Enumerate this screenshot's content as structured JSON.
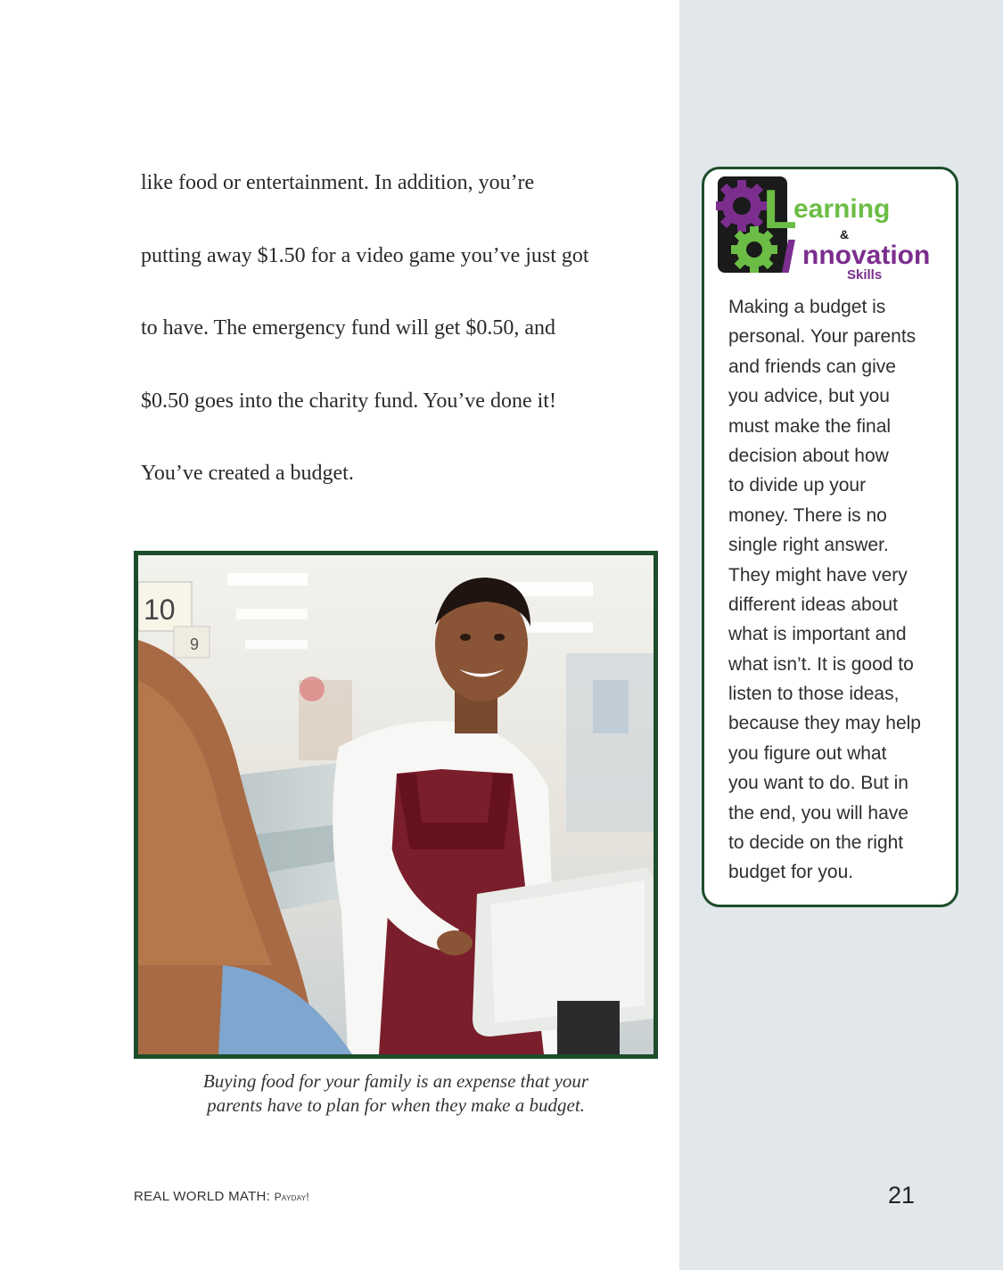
{
  "body": {
    "lines": [
      "like food or entertainment. In addition, you’re",
      "putting away $1.50 for a video game you’ve just got",
      "to have. The emergency fund will get $0.50, and",
      "$0.50 goes into the charity fund. You’ve done it!",
      "You’ve created a budget."
    ]
  },
  "photo": {
    "aisle_sign": "10",
    "aisle_sign_2": "9"
  },
  "caption": {
    "line1": "Buying food for your family is an expense that your",
    "line2": "parents have to plan for when they make a budget."
  },
  "sidebar": {
    "logo": {
      "letter_l": "L",
      "word1": "earning",
      "amp": "&",
      "letter_i": "I",
      "word2": "nnovation",
      "word3": "Skills"
    },
    "lines": [
      "Making a budget is",
      "personal. Your parents",
      "and friends can give",
      "you advice, but you",
      "must make the final",
      "decision about how",
      "to divide up your",
      "money. There is no",
      "single right answer.",
      "They might have very",
      "different ideas about",
      "what is important and",
      "what isn’t. It is good to",
      "listen to those ideas,",
      "because they may help",
      "you figure out what",
      "you want to do. But in",
      "the end, you will have",
      "to decide on the right",
      "budget for you."
    ]
  },
  "footer": {
    "series": "REAL WORLD MATH:",
    "title": "Payday!",
    "page_number": "21"
  },
  "colors": {
    "frame_green": "#1e4d2b",
    "sidebar_bg": "#e1e7ea",
    "logo_purple": "#7b2e8e",
    "logo_green": "#6cbd45"
  }
}
